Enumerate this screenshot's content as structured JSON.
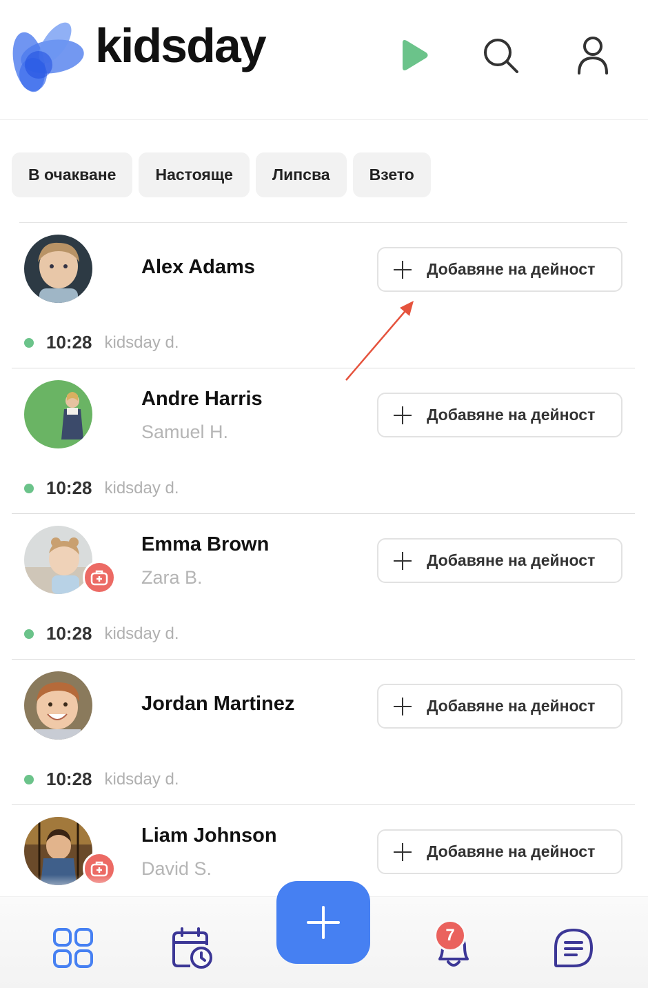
{
  "app": {
    "brand": "kidsday"
  },
  "header": {
    "icons": [
      "play-icon",
      "search-icon",
      "profile-icon"
    ]
  },
  "tabs": [
    {
      "label": "В очакване"
    },
    {
      "label": "Настояще"
    },
    {
      "label": "Липсва"
    },
    {
      "label": "Взето"
    }
  ],
  "children": [
    {
      "name": "Alex Adams",
      "guardian": "",
      "time": "10:28",
      "by": "kidsday d.",
      "medical": false,
      "action": "Добавяне на дейност"
    },
    {
      "name": "Andre Harris",
      "guardian": "Samuel H.",
      "time": "10:28",
      "by": "kidsday d.",
      "medical": false,
      "action": "Добавяне на дейност"
    },
    {
      "name": "Emma Brown",
      "guardian": "Zara B.",
      "time": "10:28",
      "by": "kidsday d.",
      "medical": true,
      "action": "Добавяне на дейност"
    },
    {
      "name": "Jordan Martinez",
      "guardian": "",
      "time": "10:28",
      "by": "kidsday d.",
      "medical": false,
      "action": "Добавяне на дейност"
    },
    {
      "name": "Liam Johnson",
      "guardian": "David S.",
      "time": "",
      "by": "",
      "medical": true,
      "action": "Добавяне на дейност"
    }
  ],
  "bottom_nav": {
    "items": [
      "grid-icon",
      "calendar-clock-icon",
      "add-icon",
      "bell-icon",
      "chat-icon"
    ],
    "notification_count": "7"
  },
  "colors": {
    "accent_blue": "#4680f2",
    "status_green": "#6bc38a",
    "badge_red": "#ea625d",
    "play_green": "#6bc38a",
    "nav_purple": "#3c3796",
    "annotation_red": "#e5533d"
  }
}
